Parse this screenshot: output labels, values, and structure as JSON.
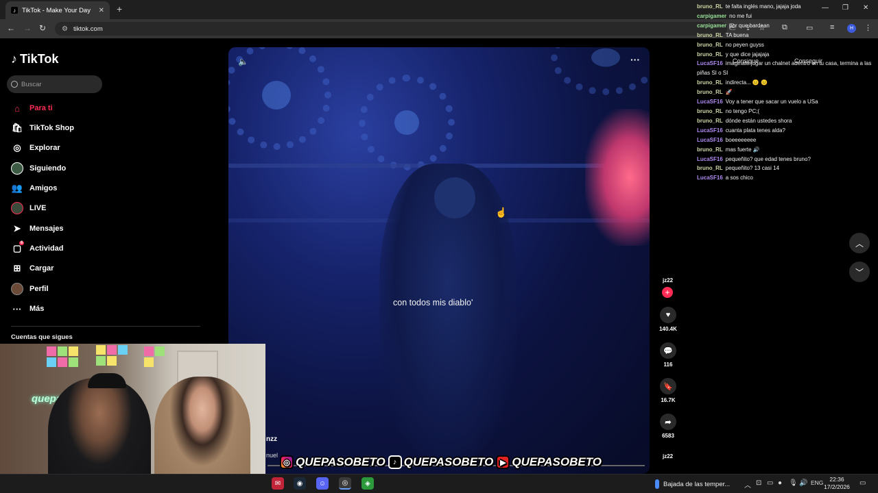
{
  "browser": {
    "tab_title": "TikTok - Make Your Day",
    "url": "tiktok.com",
    "new_tab": "+"
  },
  "tiktok": {
    "logo": "TikTok",
    "search_placeholder": "Buscar",
    "menu": [
      {
        "label": "Para ti",
        "icon": "home-icon",
        "active": true
      },
      {
        "label": "TikTok Shop",
        "icon": "shop-icon"
      },
      {
        "label": "Explorar",
        "icon": "compass-icon"
      },
      {
        "label": "Siguiendo",
        "icon": "avatar-icon"
      },
      {
        "label": "Amigos",
        "icon": "friends-icon"
      },
      {
        "label": "LIVE",
        "icon": "live-avatar-icon"
      },
      {
        "label": "Mensajes",
        "icon": "send-icon"
      },
      {
        "label": "Actividad",
        "icon": "inbox-icon",
        "badge": "6"
      },
      {
        "label": "Cargar",
        "icon": "upload-icon"
      },
      {
        "label": "Perfil",
        "icon": "profile-avatar-icon"
      },
      {
        "label": "Más",
        "icon": "more-icon"
      }
    ],
    "following_header": "Cuentas que sigues"
  },
  "video": {
    "caption": "con todos mis diablo'",
    "author_short": "nzz",
    "desc": "nuel",
    "author_handle": "jz22",
    "likes": "140.4K",
    "comments": "116",
    "saves": "16.7K",
    "shares": "6583",
    "author_handle_next": "jz22"
  },
  "chat": [
    {
      "user": "bruno_RL",
      "cls": "bruno",
      "msg": "te falta inglés mano, jajaja joda"
    },
    {
      "user": "carpigamer",
      "cls": "carpi",
      "msg": "no me fui"
    },
    {
      "user": "carpigamer",
      "cls": "carpi",
      "msg": "por que bardean"
    },
    {
      "user": "bruno_RL",
      "cls": "bruno",
      "msg": "TA buena"
    },
    {
      "user": "bruno_RL",
      "cls": "bruno",
      "msg": "no peyen guyss"
    },
    {
      "user": "bruno_RL",
      "cls": "bruno",
      "msg": "y que dice jajajaja"
    },
    {
      "user": "LucaSF16",
      "cls": "luca",
      "msg": "imaginate jugar un chalnet adentro en tu casa, termina a las"
    },
    {
      "user": "",
      "cls": "luca",
      "msg": "piñas SI o SI"
    },
    {
      "user": "bruno_RL",
      "cls": "bruno",
      "msg": "indirecta... 😐 😐"
    },
    {
      "user": "bruno_RL",
      "cls": "bruno",
      "msg": "🚀"
    },
    {
      "user": "LucaSF16",
      "cls": "luca",
      "msg": "Voy a tener que sacar un vuelo a USa"
    },
    {
      "user": "bruno_RL",
      "cls": "bruno",
      "msg": "no tengo PC;("
    },
    {
      "user": "bruno_RL",
      "cls": "bruno",
      "msg": "dónde están ustedes shora"
    },
    {
      "user": "LucaSF16",
      "cls": "luca",
      "msg": "cuanta plata tenes alda?"
    },
    {
      "user": "LucaSF16",
      "cls": "luca",
      "msg": "boeeeeeeee"
    },
    {
      "user": "bruno_RL",
      "cls": "bruno",
      "msg": "mas fuerte 🔊"
    },
    {
      "user": "LucaSF16",
      "cls": "luca",
      "msg": "pequeñito? que edad tenes bruno?"
    },
    {
      "user": "bruno_RL",
      "cls": "bruno",
      "msg": "pequeñito? 13 casi 14"
    },
    {
      "user": "LucaSF16",
      "cls": "luca",
      "msg": "a sos chico"
    }
  ],
  "page_overlay": {
    "get_app_1": "Consigue",
    "get_app_2": "Conseguir"
  },
  "webcam": {
    "neon_sign": "quepasobeto"
  },
  "social_bar": {
    "instagram": "QUEPASOBETO",
    "tiktok": "QUEPASOBETO",
    "youtube": "QUEPASOBETO"
  },
  "taskbar": {
    "weather": "Bajada de las temper...",
    "lang": "ENG",
    "time": "22:36",
    "date": "17/2/2026"
  },
  "colors": {
    "tiktok_red": "#fe2c55",
    "chat_bruno": "#cfd6a4",
    "chat_carpi": "#9be39b",
    "chat_luca": "#b08cf2"
  }
}
